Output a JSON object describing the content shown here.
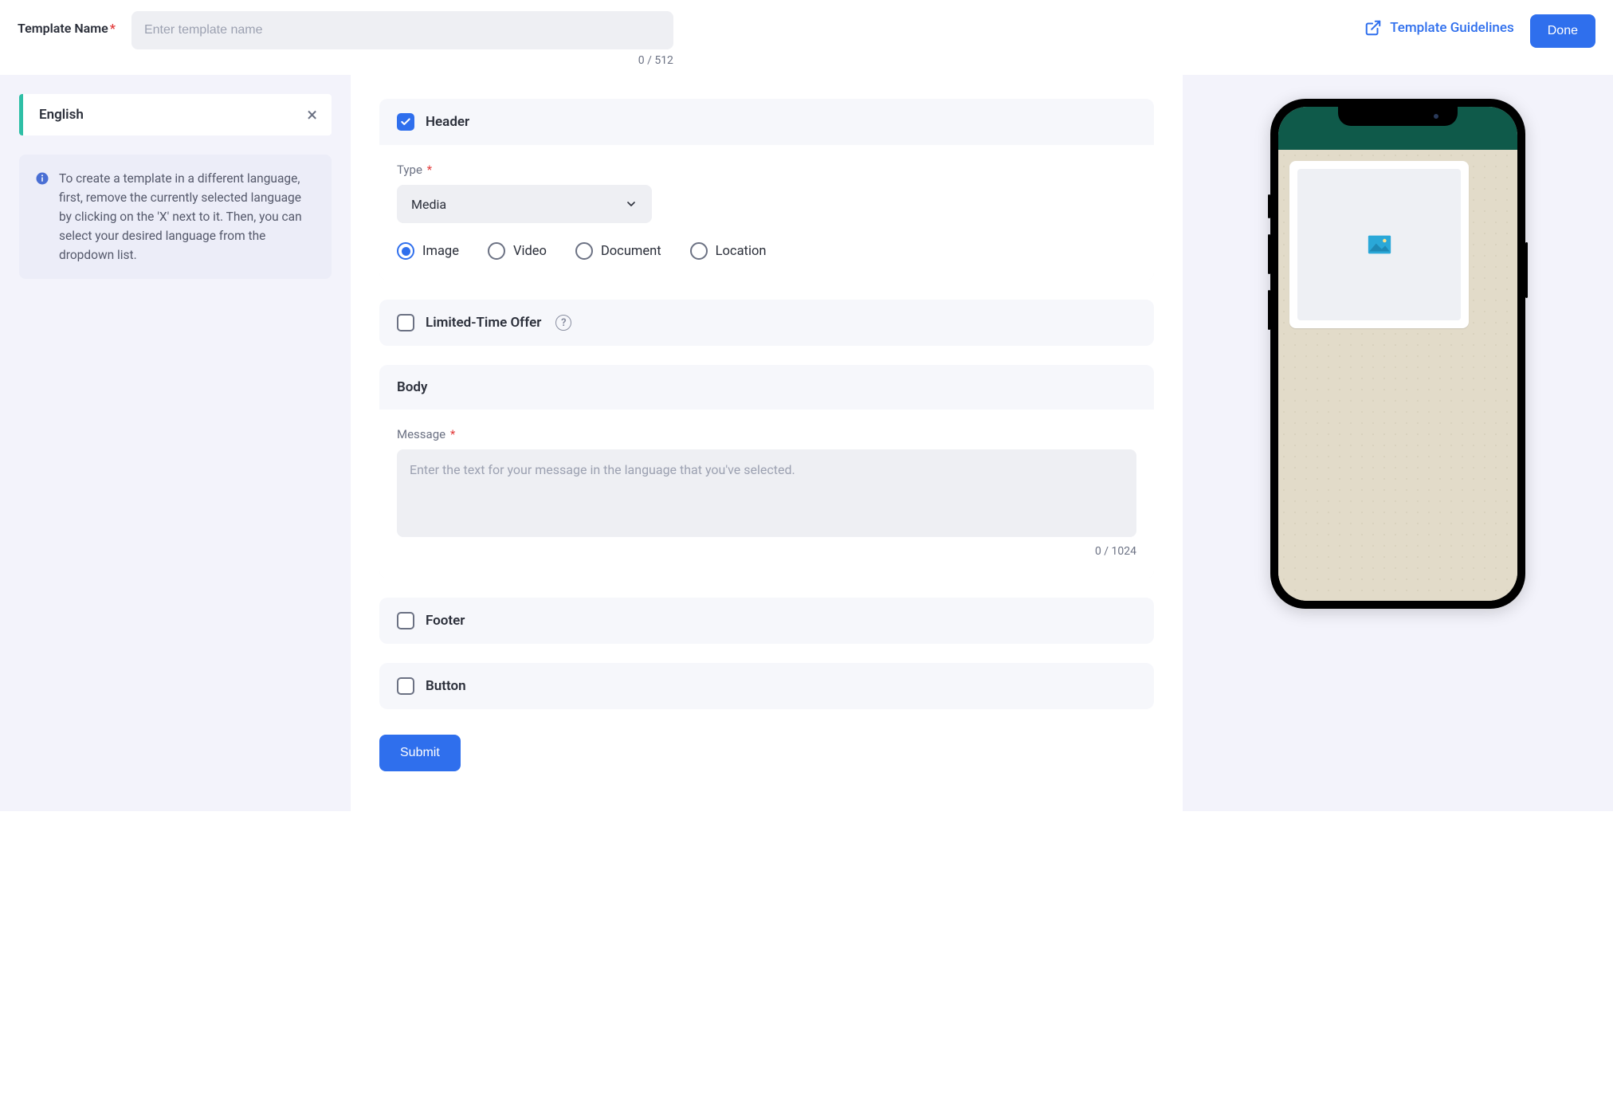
{
  "top": {
    "template_name_label": "Template Name",
    "template_name_placeholder": "Enter template name",
    "template_name_counter": "0 / 512",
    "guidelines_label": "Template Guidelines",
    "done_label": "Done"
  },
  "sidebar": {
    "language_label": "English",
    "info_text": "To create a template in a different language, first, remove the currently selected language by clicking on the 'X' next to it. Then, you can select your desired language from the dropdown list."
  },
  "form": {
    "header": {
      "title": "Header",
      "checked": true,
      "type_label": "Type",
      "type_value": "Media",
      "media_options": [
        {
          "label": "Image",
          "selected": true
        },
        {
          "label": "Video",
          "selected": false
        },
        {
          "label": "Document",
          "selected": false
        },
        {
          "label": "Location",
          "selected": false
        }
      ]
    },
    "limited_offer": {
      "title": "Limited-Time Offer",
      "checked": false
    },
    "body": {
      "title": "Body",
      "message_label": "Message",
      "message_placeholder": "Enter the text for your message in the language that you've selected.",
      "message_counter": "0 / 1024"
    },
    "footer": {
      "title": "Footer",
      "checked": false
    },
    "button": {
      "title": "Button",
      "checked": false
    },
    "submit_label": "Submit"
  },
  "colors": {
    "primary": "#2f6fed",
    "teal": "#2fbfa6",
    "wa_header": "#0f5a4a"
  }
}
